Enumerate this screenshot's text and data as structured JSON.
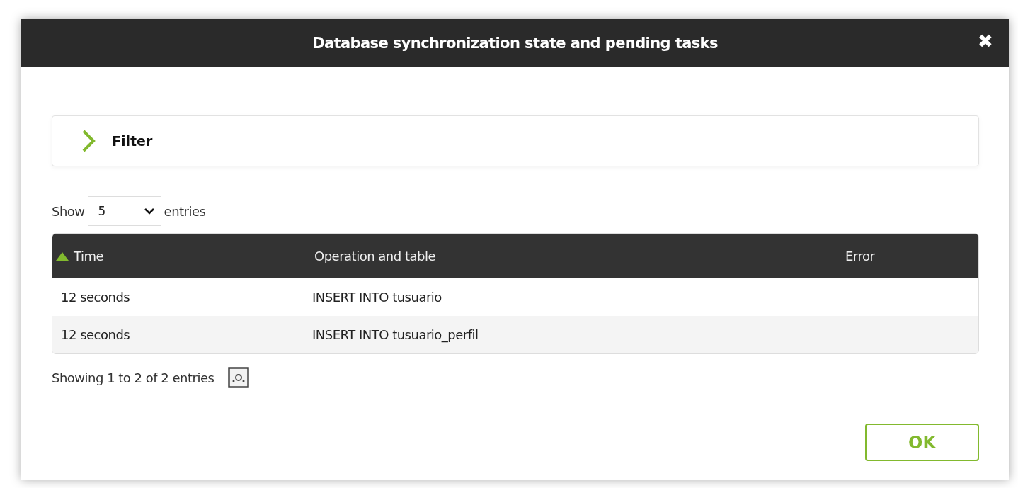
{
  "dialog": {
    "title": "Database synchronization state and pending tasks",
    "close_symbol": "✖"
  },
  "filter": {
    "label": "Filter",
    "expanded": false
  },
  "length_menu": {
    "prefix": "Show",
    "value": "5",
    "suffix": "entries"
  },
  "table": {
    "columns": [
      {
        "label": "Time",
        "sorted": true
      },
      {
        "label": "Operation and table",
        "sorted": false
      },
      {
        "label": "Error",
        "sorted": false
      }
    ],
    "rows": [
      [
        "12 seconds",
        "INSERT INTO tusuario",
        ""
      ],
      [
        "12 seconds",
        "INSERT INTO tusuario_perfil",
        ""
      ]
    ]
  },
  "info": "Showing 1 to 2 of 2 entries",
  "buttons": [
    {
      "label": "OK"
    }
  ]
}
